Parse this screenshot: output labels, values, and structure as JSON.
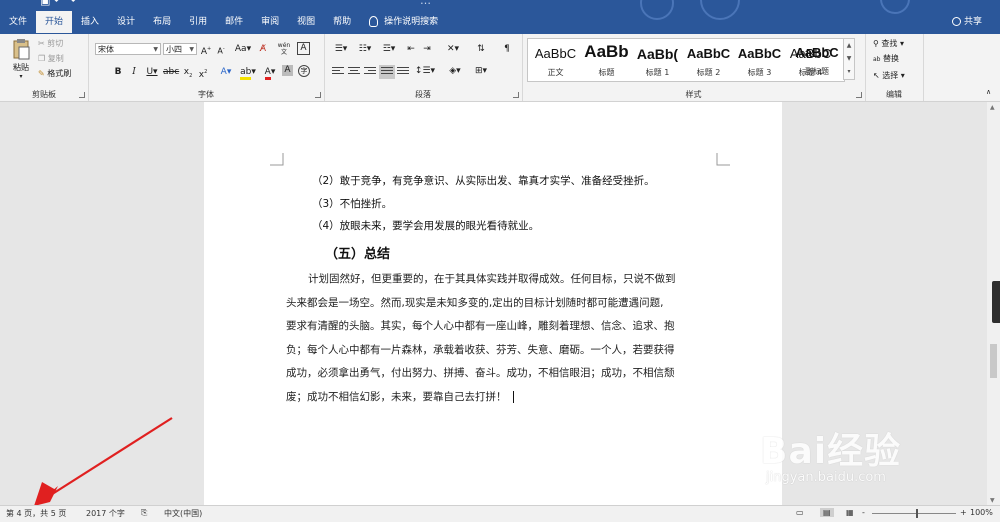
{
  "window": {
    "title_fragment": "…",
    "tabs": [
      "文件",
      "开始",
      "插入",
      "设计",
      "布局",
      "引用",
      "邮件",
      "审阅",
      "视图",
      "帮助",
      "操作说明搜索"
    ],
    "active_tab": "开始",
    "share_label": "共享"
  },
  "clipboard": {
    "paste": "粘贴",
    "cut": "剪切",
    "copy": "复制",
    "format_painter": "格式刷",
    "group": "剪贴板"
  },
  "font": {
    "name": "宋体",
    "size": "小四",
    "group": "字体"
  },
  "paragraph": {
    "group": "段落"
  },
  "styles": {
    "group": "样式",
    "items": [
      {
        "preview": "AaBbC",
        "name": "正文"
      },
      {
        "preview": "AaBb",
        "name": "标题"
      },
      {
        "preview": "AaBb(",
        "name": "标题 1"
      },
      {
        "preview": "AaBbC",
        "name": "标题 2"
      },
      {
        "preview": "AaBbC",
        "name": "标题 3"
      },
      {
        "preview": "AaBbC",
        "name": "标题 4"
      },
      {
        "preview": "AaBbC",
        "name": "副标题"
      }
    ]
  },
  "editing": {
    "find": "查找",
    "replace": "替换",
    "select": "选择",
    "group": "编辑"
  },
  "document": {
    "list_items": [
      "（2）敢于竞争，有竞争意识、从实际出发、靠真才实学、准备经受挫折。",
      "（3）不怕挫折。",
      "（4）放眼未来，要学会用发展的眼光看待就业。"
    ],
    "heading": "（五）总结",
    "paragraph_lines": [
      "计划固然好，但更重要的，在于其具体实践并取得成效。任何目标，只说不做到",
      "头来都会是一场空。然而,现实是未知多变的,定出的目标计划随时都可能遭遇问题,",
      "要求有清醒的头脑。其实，每个人心中都有一座山峰，雕刻着理想、信念、追求、抱",
      "负；每个人心中都有一片森林，承载着收获、芬芳、失意、磨砺。一个人，若要获得",
      "成功，必须拿出勇气，付出努力、拼搏、奋斗。成功，不相信眼泪；成功，不相信颓",
      "废；成功不相信幻影，未来，要靠自己去打拼！"
    ]
  },
  "status": {
    "page": "第 4 页，共 5 页",
    "words": "2017 个字",
    "language": "中文(中国)",
    "zoom": "100%",
    "zoom_minus": "-",
    "zoom_plus": "+"
  },
  "watermark": {
    "logo": "Bai经验",
    "sub": "jingyan.baidu.com"
  },
  "colors": {
    "accent": "#2b579a",
    "arrow": "#e02020"
  }
}
